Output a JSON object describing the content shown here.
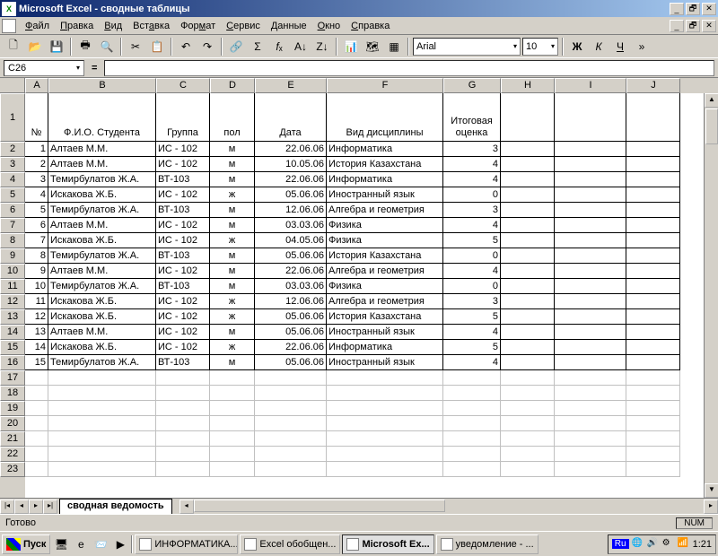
{
  "title": "Microsoft Excel - сводные таблицы",
  "menus": [
    "Файл",
    "Правка",
    "Вид",
    "Вставка",
    "Формат",
    "Сервис",
    "Данные",
    "Окно",
    "Справка"
  ],
  "font": {
    "name": "Arial",
    "size": "10"
  },
  "namebox": "C26",
  "cols": [
    "A",
    "B",
    "C",
    "D",
    "E",
    "F",
    "G",
    "H",
    "I",
    "J"
  ],
  "headers": {
    "A": "№",
    "B": "Ф.И.О. Студента",
    "C": "Группа",
    "D": "пол",
    "E": "Дата",
    "F": "Вид дисциплины",
    "G": "Итоговая оценка"
  },
  "rows": [
    {
      "n": "1",
      "fio": "Алтаев М.М.",
      "grp": "ИС - 102",
      "pol": "м",
      "date": "22.06.06",
      "disc": "Информатика",
      "gr": "3"
    },
    {
      "n": "2",
      "fio": "Алтаев М.М.",
      "grp": "ИС - 102",
      "pol": "м",
      "date": "10.05.06",
      "disc": "История Казахстана",
      "gr": "4"
    },
    {
      "n": "3",
      "fio": "Темирбулатов Ж.А.",
      "grp": "ВТ-103",
      "pol": "м",
      "date": "22.06.06",
      "disc": "Информатика",
      "gr": "4"
    },
    {
      "n": "4",
      "fio": "Искакова Ж.Б.",
      "grp": "ИС - 102",
      "pol": "ж",
      "date": "05.06.06",
      "disc": "Иностранный язык",
      "gr": "0"
    },
    {
      "n": "5",
      "fio": "Темирбулатов Ж.А.",
      "grp": "ВТ-103",
      "pol": "м",
      "date": "12.06.06",
      "disc": "Алгебра и геометрия",
      "gr": "3"
    },
    {
      "n": "6",
      "fio": "Алтаев М.М.",
      "grp": "ИС - 102",
      "pol": "м",
      "date": "03.03.06",
      "disc": "Физика",
      "gr": "4"
    },
    {
      "n": "7",
      "fio": "Искакова Ж.Б.",
      "grp": "ИС - 102",
      "pol": "ж",
      "date": "04.05.06",
      "disc": "Физика",
      "gr": "5"
    },
    {
      "n": "8",
      "fio": "Темирбулатов Ж.А.",
      "grp": "ВТ-103",
      "pol": "м",
      "date": "05.06.06",
      "disc": "История Казахстана",
      "gr": "0"
    },
    {
      "n": "9",
      "fio": "Алтаев М.М.",
      "grp": "ИС - 102",
      "pol": "м",
      "date": "22.06.06",
      "disc": "Алгебра и геометрия",
      "gr": "4"
    },
    {
      "n": "10",
      "fio": "Темирбулатов Ж.А.",
      "grp": "ВТ-103",
      "pol": "м",
      "date": "03.03.06",
      "disc": "Физика",
      "gr": "0"
    },
    {
      "n": "11",
      "fio": "Искакова Ж.Б.",
      "grp": "ИС - 102",
      "pol": "ж",
      "date": "12.06.06",
      "disc": "Алгебра и геометрия",
      "gr": "3"
    },
    {
      "n": "12",
      "fio": "Искакова Ж.Б.",
      "grp": "ИС - 102",
      "pol": "ж",
      "date": "05.06.06",
      "disc": "История Казахстана",
      "gr": "5"
    },
    {
      "n": "13",
      "fio": "Алтаев М.М.",
      "grp": "ИС - 102",
      "pol": "м",
      "date": "05.06.06",
      "disc": "Иностранный язык",
      "gr": "4"
    },
    {
      "n": "14",
      "fio": "Искакова Ж.Б.",
      "grp": "ИС - 102",
      "pol": "ж",
      "date": "22.06.06",
      "disc": "Информатика",
      "gr": "5"
    },
    {
      "n": "15",
      "fio": "Темирбулатов Ж.А.",
      "grp": "ВТ-103",
      "pol": "м",
      "date": "05.06.06",
      "disc": "Иностранный язык",
      "gr": "4"
    }
  ],
  "sheet_tab": "сводная ведомость",
  "status": "Готово",
  "status_ind": "NUM",
  "taskbar": {
    "start": "Пуск",
    "tasks": [
      "ИНФОРМАТИКА...",
      "Excel обобщен...",
      "Microsoft Ex...",
      "уведомление - ..."
    ],
    "lang": "Ru",
    "clock": "1:21"
  }
}
